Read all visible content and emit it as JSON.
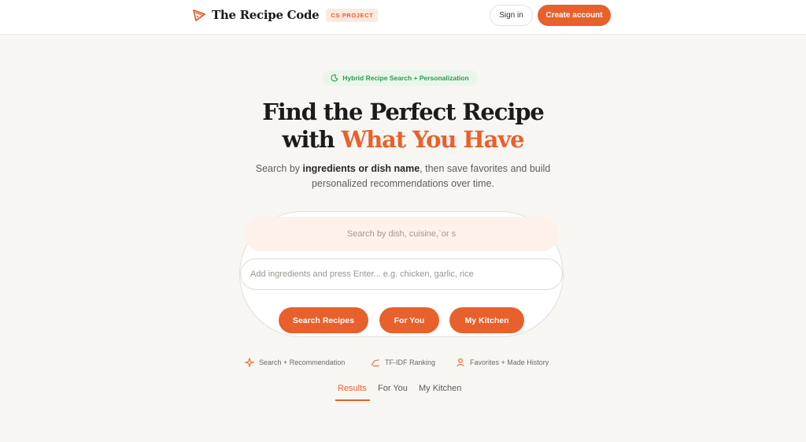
{
  "header": {
    "brand_name": "The Recipe Code",
    "badge": "CS PROJECT",
    "signin_label": "Sign in",
    "create_account_label": "Create account"
  },
  "hero": {
    "pill_text": "Hybrid Recipe Search + Personalization",
    "title_line1": "Find the Perfect Recipe",
    "title_line2_prefix": "with",
    "title_line2_accent": "What You Have",
    "subtitle_prefix": "Search by",
    "subtitle_bold": "ingredients or dish name",
    "subtitle_suffix": ", then save favorites and build",
    "subtitle_line2": "personalized recommendations over time."
  },
  "search": {
    "dish_value": "Search by dish, cuisine,ˋor s",
    "ingredient_placeholder": "Add ingredients and press Enter... e.g. chicken, garlic, rice",
    "buttons": [
      "Search Recipes",
      "For You",
      "My Kitchen"
    ]
  },
  "features": [
    {
      "icon": "sparkle-icon",
      "label": "Search + Recommendation"
    },
    {
      "icon": "trend-icon",
      "label": "TF-IDF Ranking"
    },
    {
      "icon": "user-icon",
      "label": "Favorites + Made History"
    }
  ],
  "tabs": [
    {
      "label": "Results",
      "active": true
    },
    {
      "label": "For You",
      "active": false
    },
    {
      "label": "My Kitchen",
      "active": false
    }
  ],
  "colors": {
    "accent": "#e8602c",
    "background": "#f7f6f2",
    "pill_green": "#2f9a4c"
  }
}
